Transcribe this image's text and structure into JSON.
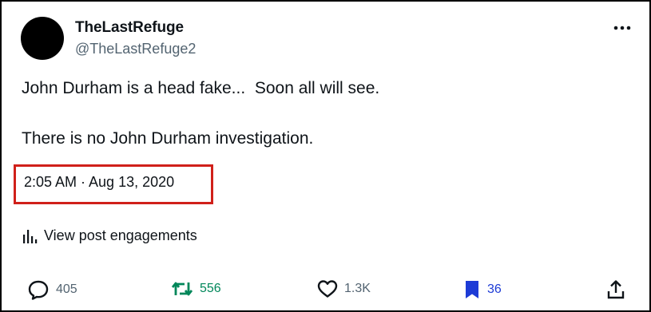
{
  "author": {
    "display_name": "TheLastRefuge",
    "handle": "@TheLastRefuge2"
  },
  "post": {
    "line1": "John Durham is a head fake...  Soon all will see.",
    "line2": "There is no John Durham investigation.",
    "timestamp": "2:05 AM · Aug 13, 2020",
    "highlight_color": "#d0201a"
  },
  "engagements_link": "View post engagements",
  "actions": {
    "replies": "405",
    "reposts": "556",
    "likes": "1.3K",
    "bookmarks": "36"
  },
  "colors": {
    "repost": "#00875a",
    "bookmark": "#1d3bd6",
    "text": "#0f1419",
    "secondary": "#536471"
  },
  "icons": [
    "more-icon",
    "analytics-icon",
    "reply-icon",
    "repost-icon",
    "like-icon",
    "bookmark-icon",
    "share-icon"
  ]
}
